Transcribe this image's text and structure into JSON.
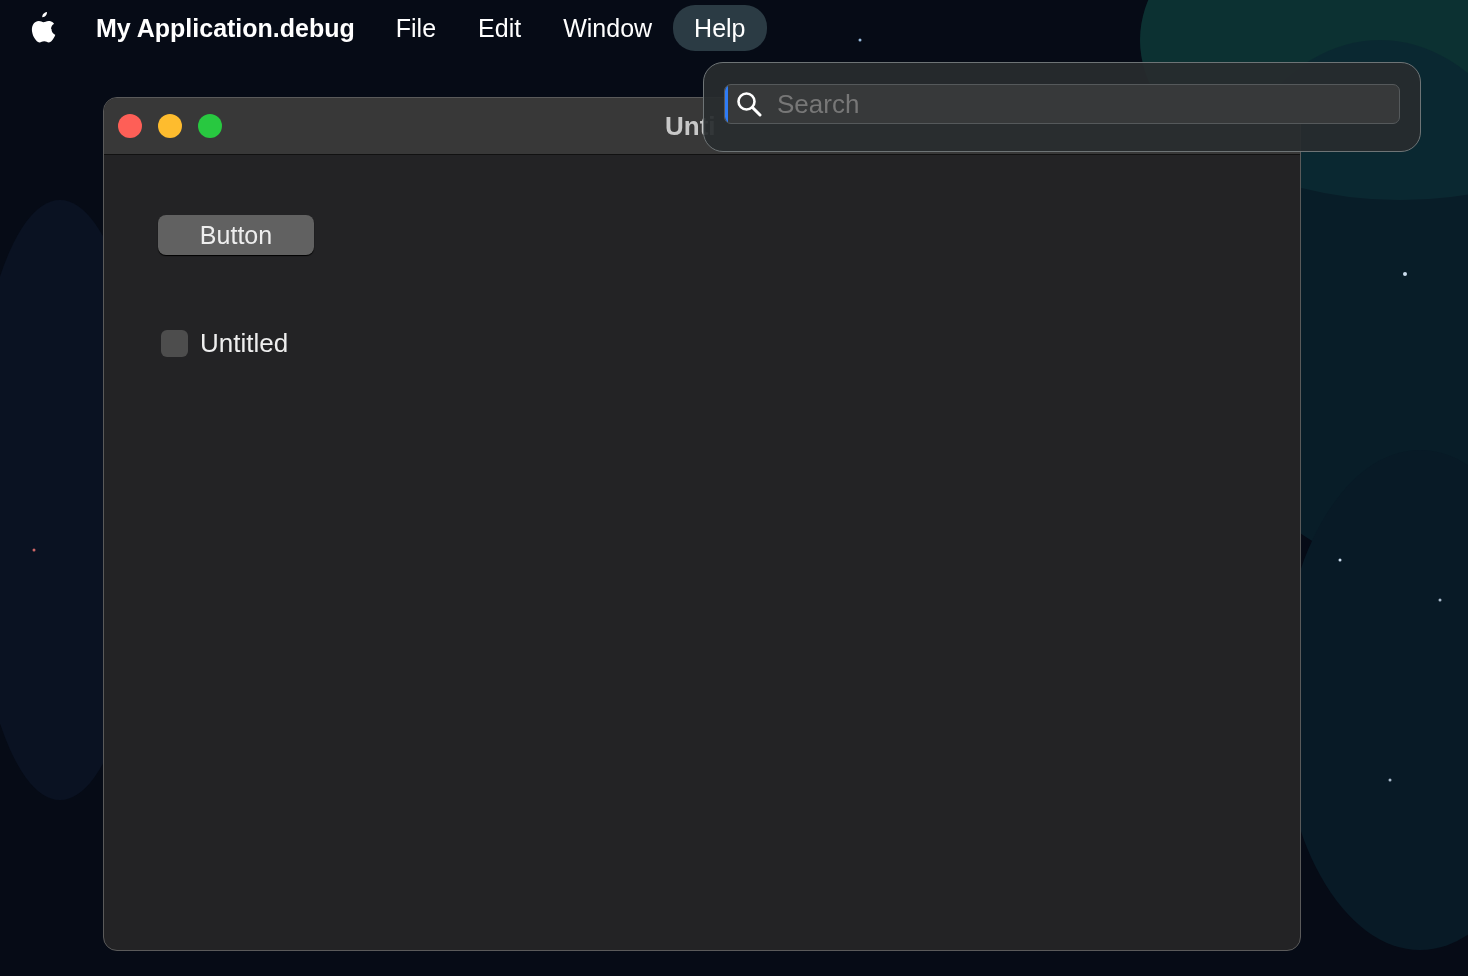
{
  "menu_bar": {
    "app_name": "My Application.debug",
    "items": [
      {
        "label": "File",
        "selected": false
      },
      {
        "label": "Edit",
        "selected": false
      },
      {
        "label": "Window",
        "selected": false
      },
      {
        "label": "Help",
        "selected": true
      }
    ]
  },
  "window": {
    "title": "Unti",
    "button": "Button",
    "checkbox": {
      "label": "Untitled",
      "checked": false
    }
  },
  "help_menu": {
    "search": {
      "placeholder": "Search"
    }
  }
}
